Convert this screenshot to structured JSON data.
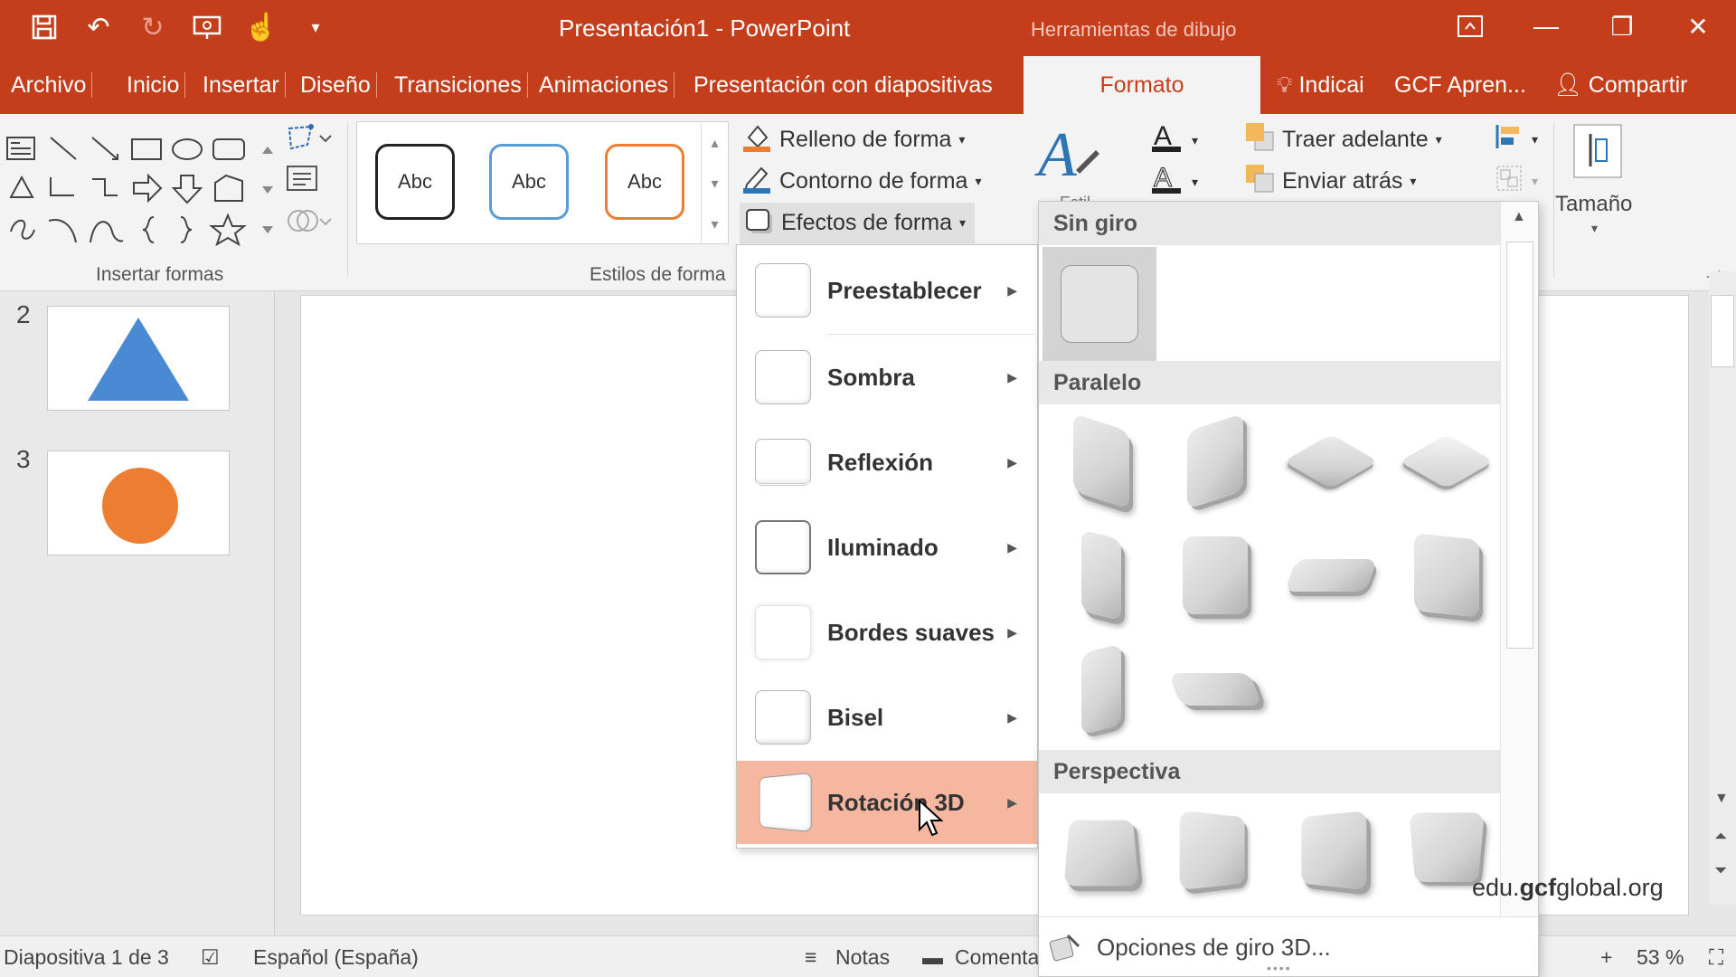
{
  "titlebar": {
    "title": "Presentación1 - PowerPoint",
    "context_tools": "Herramientas de dibujo",
    "bg_color": "#c43e1c"
  },
  "tabs": [
    {
      "label": "Archivo"
    },
    {
      "label": "Inicio"
    },
    {
      "label": "Insertar"
    },
    {
      "label": "Diseño"
    },
    {
      "label": "Transiciones"
    },
    {
      "label": "Animaciones"
    },
    {
      "label": "Presentación con diapositivas"
    },
    {
      "label": "Formato"
    }
  ],
  "tellme": "Indicai",
  "addin": "GCF Apren...",
  "share": "Compartir",
  "ribbon": {
    "insert_shapes_label": "Insertar formas",
    "shape_styles_label": "Estilos de forma",
    "style_sample": "Abc",
    "shape_fill": "Relleno de forma",
    "shape_outline": "Contorno de forma",
    "shape_effects": "Efectos de forma",
    "bring_forward": "Traer adelante",
    "send_backward": "Enviar atrás",
    "size_label": "Tamaño",
    "wordart_partial": "Estil"
  },
  "slides": [
    {
      "number": "2",
      "shape": "triangle",
      "color": "#4a8ad4"
    },
    {
      "number": "3",
      "shape": "circle",
      "color": "#ed7d31"
    }
  ],
  "effects_menu": {
    "items": [
      {
        "label": "Preestablecer"
      },
      {
        "label": "Sombra"
      },
      {
        "label": "Reflexión"
      },
      {
        "label": "Iluminado"
      },
      {
        "label": "Bordes suaves"
      },
      {
        "label": "Bisel"
      },
      {
        "label": "Rotación 3D",
        "hovered": true
      }
    ],
    "hover_color": "#f5b79f"
  },
  "rotation_gallery": {
    "sections": [
      {
        "title": "Sin giro"
      },
      {
        "title": "Paralelo"
      },
      {
        "title": "Perspectiva"
      }
    ],
    "options_link": "Opciones de giro 3D..."
  },
  "statusbar": {
    "slide_info": "Diapositiva 1 de 3",
    "language": "Español (España)",
    "notes": "Notas",
    "comments": "Comenta",
    "zoom": "53 %"
  },
  "watermark": {
    "prefix": "edu.",
    "brand": "gcf",
    "suffix": "global.org"
  }
}
